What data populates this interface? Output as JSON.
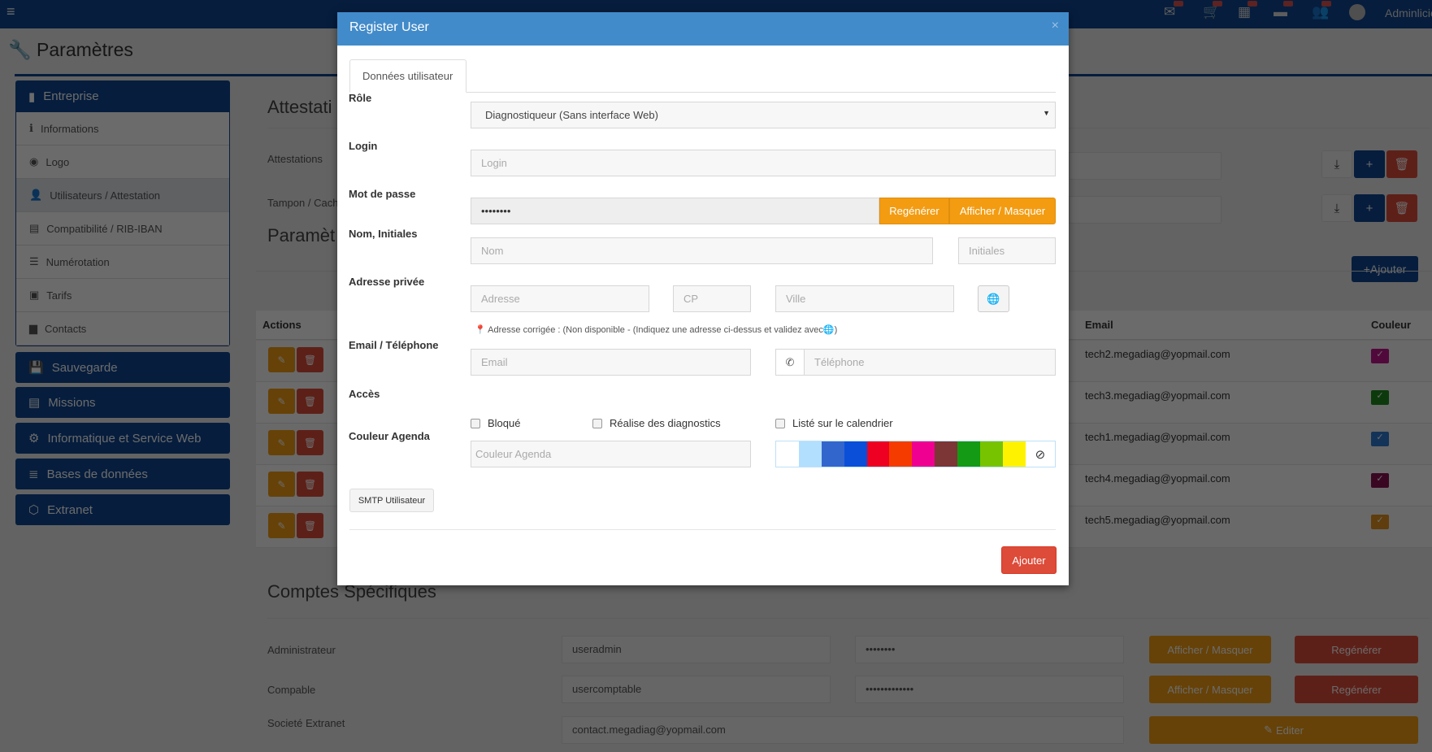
{
  "topbar": {
    "user": "Adminlicie",
    "icons": [
      "envelope-icon",
      "cart-icon",
      "calendar-icon",
      "card-icon",
      "users-icon",
      "avatar-icon"
    ]
  },
  "page": {
    "title": "Paramètres"
  },
  "sidebar": {
    "entreprise": "Entreprise",
    "items": [
      {
        "label": "Informations",
        "icon": "ℹ"
      },
      {
        "label": "Logo",
        "icon": "◉"
      },
      {
        "label": "Utilisateurs / Attestation",
        "icon": "👤"
      },
      {
        "label": "Compatibilité / RIB-IBAN",
        "icon": "▤"
      },
      {
        "label": "Numérotation",
        "icon": "☰"
      },
      {
        "label": "Tarifs",
        "icon": "▣"
      },
      {
        "label": "Contacts",
        "icon": "▆"
      }
    ],
    "sections": [
      {
        "label": "Sauvegarde",
        "icon": "💾"
      },
      {
        "label": "Missions",
        "icon": "▤"
      },
      {
        "label": "Informatique et Service Web",
        "icon": "⚙"
      },
      {
        "label": "Bases de données",
        "icon": "≣"
      },
      {
        "label": "Extranet",
        "icon": "⬡"
      }
    ]
  },
  "content": {
    "attest_title": "Attestati",
    "attest_label": "Attestations",
    "tampon_label": "Tampon / Cach",
    "param_title": "Paramèt",
    "ajouter": "Ajouter",
    "table": {
      "actions": "Actions",
      "email": "Email",
      "couleur": "Couleur",
      "rows": [
        {
          "email": "tech2.megadiag@yopmail.com",
          "color": "#c2168f"
        },
        {
          "email": "tech3.megadiag@yopmail.com",
          "color": "#1d8a1d"
        },
        {
          "email": "tech1.megadiag@yopmail.com",
          "color": "#2e7dd1"
        },
        {
          "email": "tech4.megadiag@yopmail.com",
          "color": "#8a1050"
        },
        {
          "email": "tech5.megadiag@yopmail.com",
          "color": "#e3921f"
        }
      ]
    },
    "comptes_title": "Comptes Spécifiques",
    "comptes": [
      {
        "label": "Administrateur",
        "login": "useradmin",
        "password": "••••••••",
        "show": "Afficher / Masquer",
        "regen": "Regénérer"
      },
      {
        "label": "Compable",
        "login": "usercomptable",
        "password": "•••••••••••••",
        "show": "Afficher / Masquer",
        "regen": "Regénérer"
      }
    ],
    "extranet": {
      "label": "Societé Extranet",
      "email": "contact.megadiag@yopmail.com",
      "edit": "Editer"
    }
  },
  "modal": {
    "title": "Register User",
    "close": "×",
    "tab": "Données utilisateur",
    "role_label": "Rôle",
    "role_value": "Diagnostiqueur (Sans interface Web)",
    "login_label": "Login",
    "login_placeholder": "Login",
    "password_label": "Mot de passe",
    "password_value": "••••••••",
    "regen": "Regénérer",
    "show": "Afficher / Masquer",
    "nom_label": "Nom, Initiales",
    "nom_placeholder": "Nom",
    "initiales_placeholder": "Initiales",
    "adresse_label": "Adresse privée",
    "adresse_placeholder": "Adresse",
    "cp_placeholder": "CP",
    "ville_placeholder": "Ville",
    "adresse_note_label": "Adresse corrigée :",
    "adresse_note": "(Non disponible - (Indiquez une adresse ci-dessus et validez avec",
    "email_label": "Email / Téléphone",
    "email_placeholder": "Email",
    "tel_placeholder": "Téléphone",
    "acces_label": "Accès",
    "checkboxes": [
      {
        "label": "Bloqué",
        "checked": false
      },
      {
        "label": "Réalise des diagnostics",
        "checked": false
      },
      {
        "label": "Listé sur le calendrier",
        "checked": false
      }
    ],
    "couleur_label": "Couleur Agenda",
    "couleur_placeholder": "Couleur Agenda",
    "palette": [
      "#ffffff",
      "#b3dfff",
      "#3366cc",
      "#0b4fd9",
      "#ee0022",
      "#f53b00",
      "#ef0090",
      "#7c3636",
      "#149a14",
      "#77c300",
      "#fff200"
    ],
    "smtp": "SMTP Utilisateur",
    "submit": "Ajouter"
  }
}
